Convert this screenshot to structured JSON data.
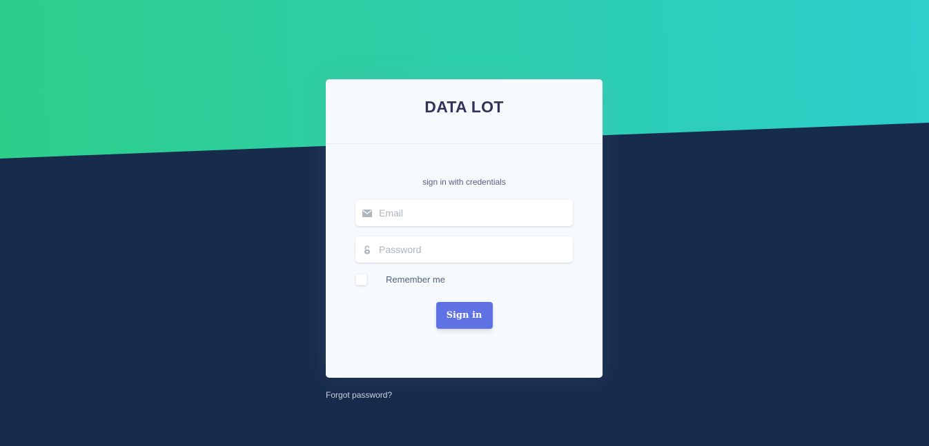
{
  "brand": {
    "title": "DATA LOT"
  },
  "login": {
    "subtitle": "sign in with credentials",
    "email_placeholder": "Email",
    "email_value": "",
    "password_placeholder": "Password",
    "password_value": "",
    "remember_label": "Remember me",
    "remember_checked": false,
    "signin_label": "Sign in"
  },
  "footer": {
    "forgot_label": "Forgot password?"
  },
  "icons": {
    "email": "envelope-icon",
    "password": "unlock-icon"
  },
  "colors": {
    "gradient_start": "#2dce89",
    "gradient_end": "#2dcecc",
    "background": "#172b4d",
    "card": "#f7fafc",
    "primary": "#5e72e4",
    "title": "#32325d"
  }
}
